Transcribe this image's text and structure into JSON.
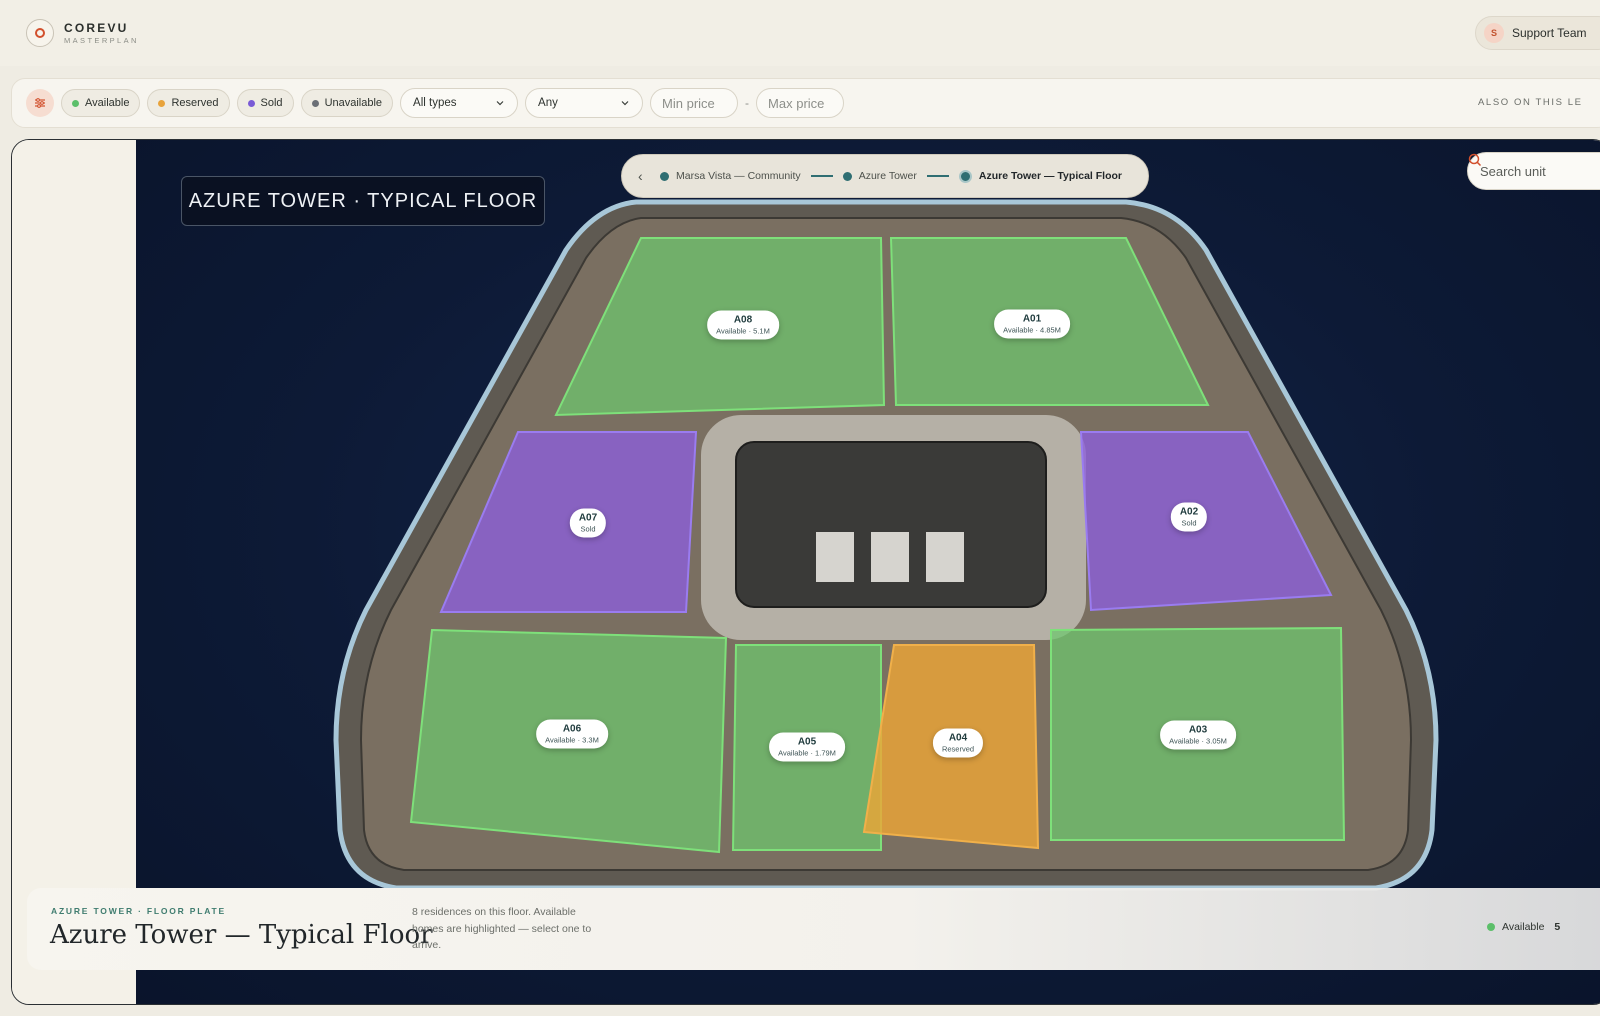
{
  "brand": {
    "name": "COREVU",
    "sub": "MASTERPLAN"
  },
  "support": {
    "avatar_letter": "S",
    "label": "Support Team"
  },
  "filters": {
    "statuses": [
      {
        "label": "Available",
        "color": "#5cbf6a"
      },
      {
        "label": "Reserved",
        "color": "#e8a33b"
      },
      {
        "label": "Sold",
        "color": "#7a5bd6"
      },
      {
        "label": "Unavailable",
        "color": "#6b6f76"
      }
    ],
    "type_select": "All types",
    "bedroom_select": "Any",
    "min_price_placeholder": "Min price",
    "max_price_placeholder": "Max price",
    "separator": "-",
    "also_label": "ALSO ON THIS LE"
  },
  "map": {
    "title": "AZURE TOWER · TYPICAL FLOOR",
    "breadcrumb": [
      "Marsa Vista — Community",
      "Azure Tower",
      "Azure Tower — Typical Floor"
    ],
    "search_placeholder": "Search unit",
    "units": [
      {
        "id": "A08",
        "status": "Available · 5.1M",
        "state": "available"
      },
      {
        "id": "A01",
        "status": "Available · 4.85M",
        "state": "available"
      },
      {
        "id": "A07",
        "status": "Sold",
        "state": "sold"
      },
      {
        "id": "A02",
        "status": "Sold",
        "state": "sold"
      },
      {
        "id": "A06",
        "status": "Available · 3.3M",
        "state": "available"
      },
      {
        "id": "A05",
        "status": "Available · 1.79M",
        "state": "available"
      },
      {
        "id": "A04",
        "status": "Reserved",
        "state": "reserved"
      },
      {
        "id": "A03",
        "status": "Available · 3.05M",
        "state": "available"
      }
    ]
  },
  "floor_card": {
    "eyebrow": "AZURE TOWER · FLOOR PLATE",
    "title": "Azure Tower — Typical Floor",
    "description": "8 residences on this floor. Available homes are highlighted — select one to arrive.",
    "legend_label": "Available",
    "legend_count": "5"
  }
}
